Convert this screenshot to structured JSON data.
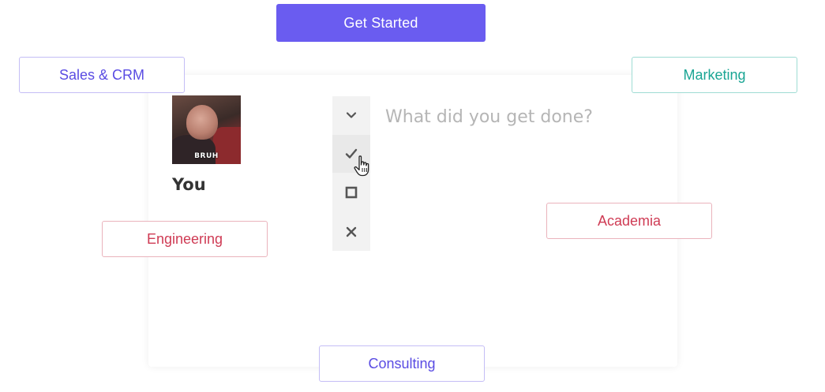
{
  "header": {
    "cta_label": "Get Started"
  },
  "categories": {
    "sales_crm": "Sales & CRM",
    "marketing": "Marketing",
    "engineering": "Engineering",
    "academia": "Academia",
    "consulting": "Consulting"
  },
  "card": {
    "avatar_caption": "BRUH",
    "user_name": "You",
    "prompt_placeholder": "What did you get done?",
    "status_options": [
      {
        "icon": "chevron-down-icon"
      },
      {
        "icon": "check-icon"
      },
      {
        "icon": "square-icon"
      },
      {
        "icon": "x-icon"
      }
    ]
  },
  "colors": {
    "accent": "#6a5cf0",
    "purple_tag": "#5a4ce3",
    "teal_tag": "#1aa594",
    "red_tag": "#cf3b54"
  }
}
